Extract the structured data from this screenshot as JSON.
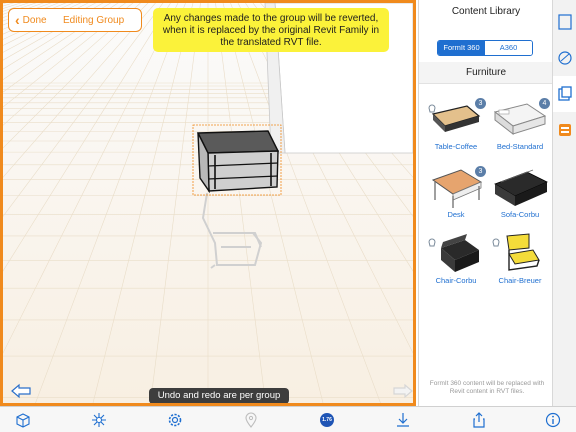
{
  "header": {
    "done_label": "Done",
    "editing_label": "Editing Group"
  },
  "tooltip": {
    "text": "Any changes made to the group will be reverted, when it is replaced by the original Revit Family in the translated RVT file."
  },
  "hint": {
    "text": "Undo and redo are per group"
  },
  "library": {
    "title": "Content Library",
    "sources": [
      "FormIt 360",
      "A360"
    ],
    "active_source": "FormIt 360",
    "category": "Furniture",
    "items": [
      {
        "label": "Table-Coffee",
        "badge": "3"
      },
      {
        "label": "Bed-Standard",
        "badge": "4"
      },
      {
        "label": "Desk",
        "badge": "3"
      },
      {
        "label": "Sofa-Corbu",
        "badge": ""
      },
      {
        "label": "Chair-Corbu",
        "badge": ""
      },
      {
        "label": "Chair-Breuer",
        "badge": ""
      }
    ],
    "note": "FormIt 360 content will be replaced with Revit content in RVT files."
  },
  "toolbar": {
    "count_badge": "1.76"
  },
  "colors": {
    "accent": "#f08a1d",
    "tooltip_bg": "#fbf23a",
    "link_blue": "#1f6fd0",
    "grid_line": "#e9ddc8"
  },
  "icons": {
    "side_tabs": [
      "properties-icon",
      "materials-icon",
      "content-library-icon",
      "layers-icon"
    ],
    "toolbar": [
      "add-object-icon",
      "tools-icon",
      "settings-icon",
      "location-icon",
      "count-badge",
      "download-icon",
      "share-icon",
      "info-icon"
    ]
  }
}
